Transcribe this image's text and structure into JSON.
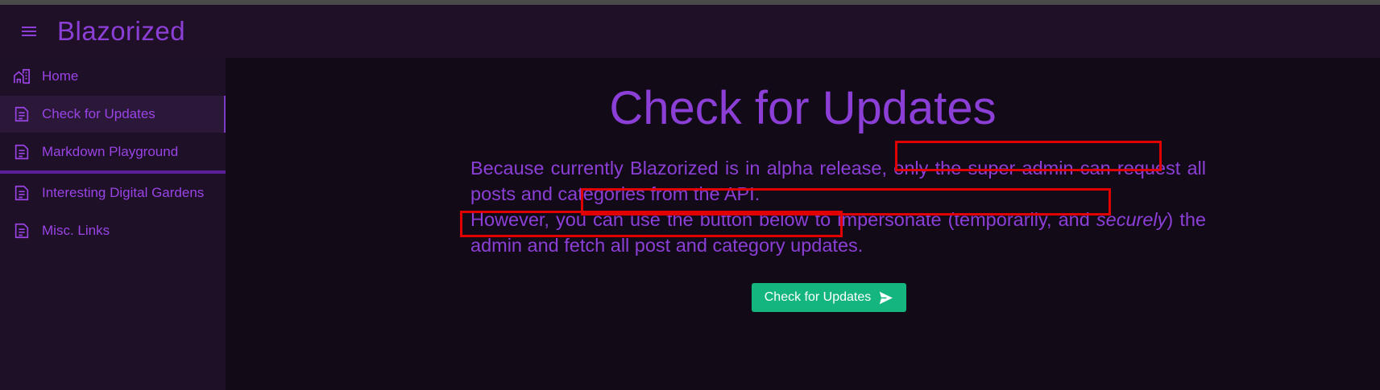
{
  "app": {
    "title": "Blazorized"
  },
  "sidebar": {
    "items": [
      {
        "label": "Home",
        "icon": "home-icon"
      },
      {
        "label": "Check for Updates",
        "icon": "document-icon",
        "active": true
      },
      {
        "label": "Markdown Playground",
        "icon": "document-icon"
      },
      {
        "label": "Interesting Digital Gardens",
        "icon": "document-icon"
      },
      {
        "label": "Misc. Links",
        "icon": "document-icon"
      }
    ]
  },
  "main": {
    "title": "Check for Updates",
    "paragraph": {
      "line1": "Because currently Blazorized is in alpha release, only the super admin can request all posts and categories from the API.",
      "line2_before": "However, you can use the button below to impersonate (temporarily, and ",
      "line2_emphasis": "securely",
      "line2_after": ") the admin and fetch all post and category updates."
    },
    "button": {
      "label": "Check for Updates",
      "icon": "send-icon"
    }
  },
  "colors": {
    "accent": "#8c3fd6",
    "button": "#14b57e",
    "highlight": "#e00000",
    "background": "#120a17",
    "sidebar": "#1e1027"
  }
}
